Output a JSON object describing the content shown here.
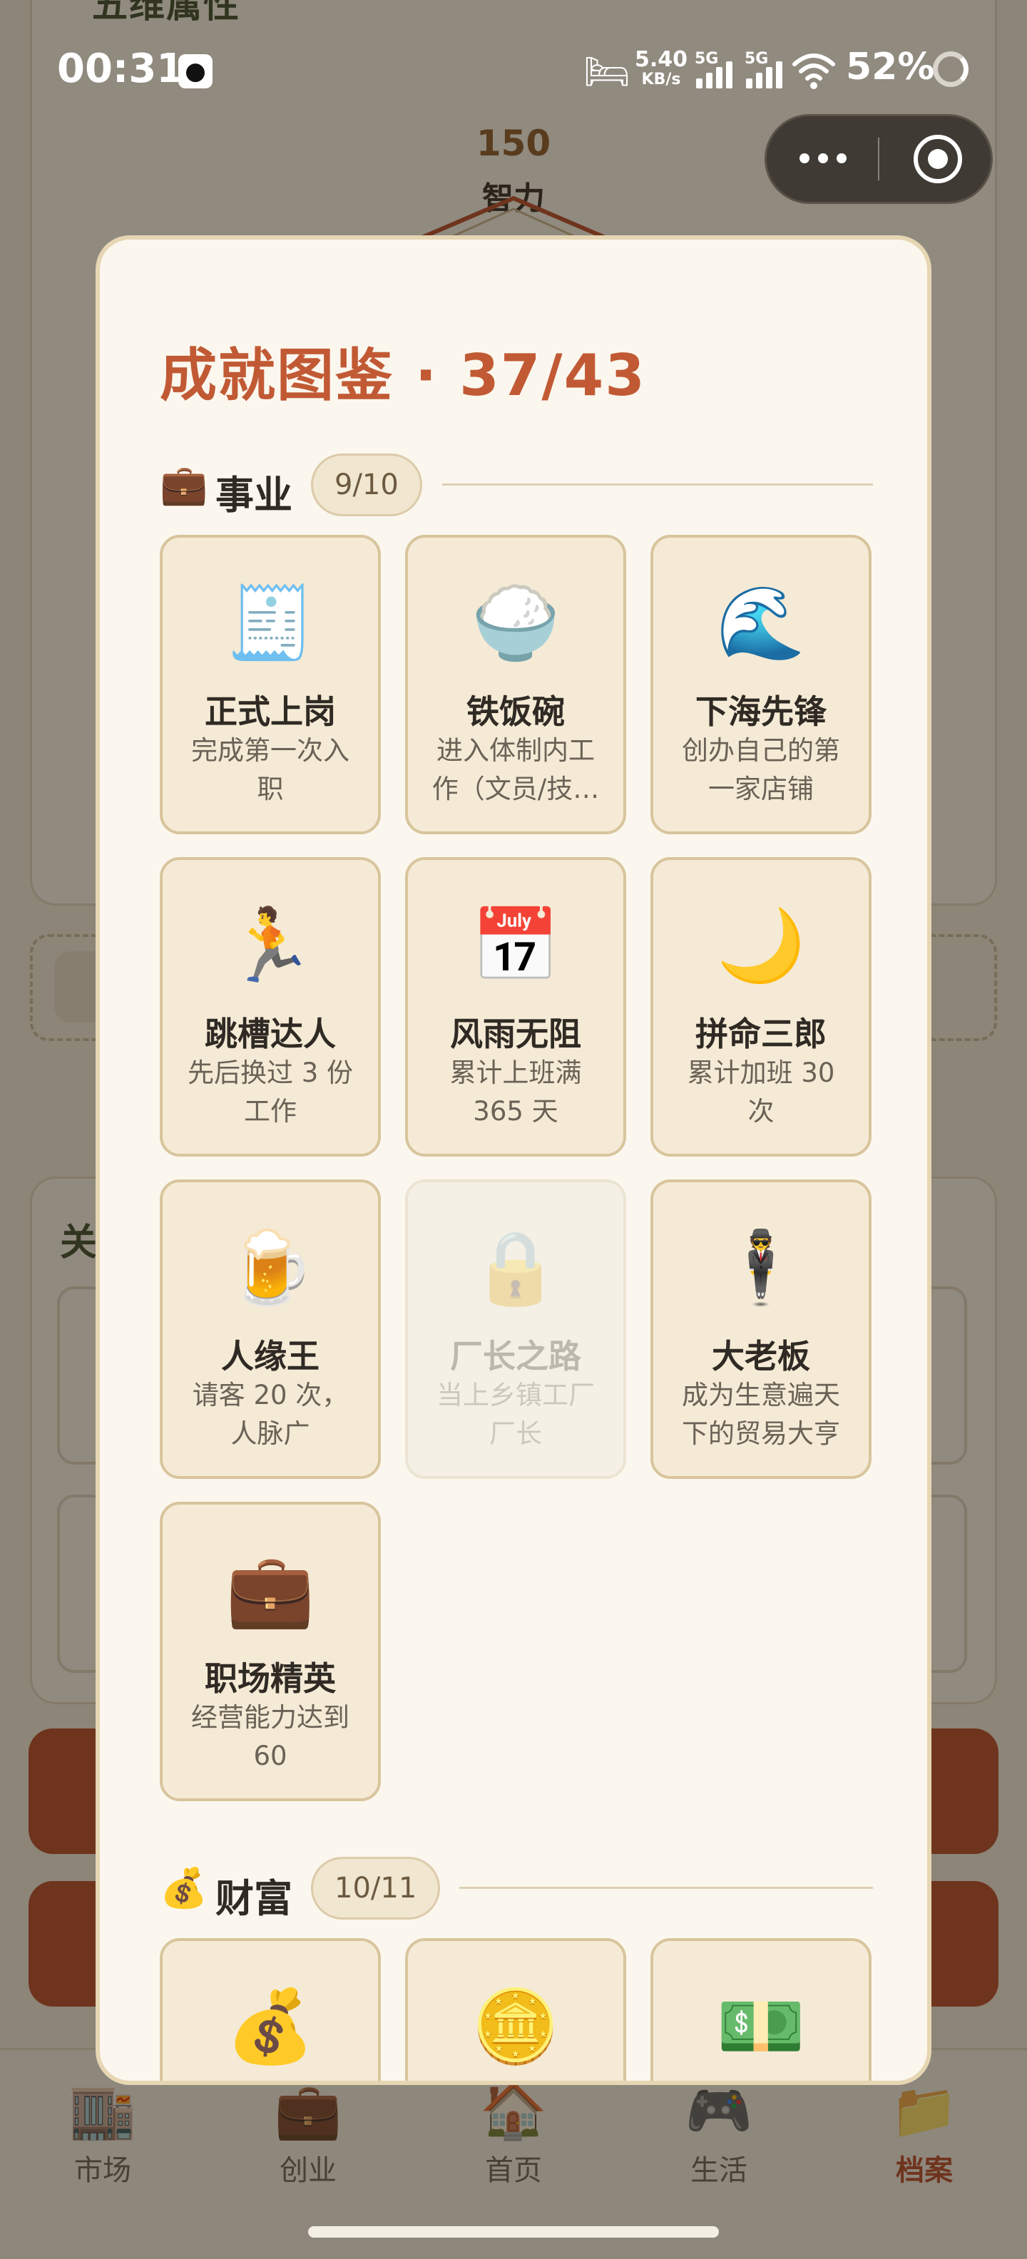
{
  "background": {
    "title": "五维属性",
    "radar_value": "150",
    "radar_label": "智力",
    "section_letter": "关"
  },
  "status_bar": {
    "time": "00:31",
    "speed_value": "5.40",
    "speed_unit": "KB/s",
    "signal_1": "5G",
    "signal_2": "5G",
    "battery": "52%"
  },
  "modal": {
    "title": "成就图鉴 · 37/43",
    "sections": [
      {
        "icon": "💼",
        "label": "事业",
        "count": "9/10",
        "items": [
          {
            "icon": "🧾",
            "name": "正式上岗",
            "desc": "完成第一次入职",
            "locked": false
          },
          {
            "icon": "🍚",
            "name": "铁饭碗",
            "desc": "进入体制内工作（文员/技术员）",
            "locked": false
          },
          {
            "icon": "🌊",
            "name": "下海先锋",
            "desc": "创办自己的第一家店铺",
            "locked": false
          },
          {
            "icon": "🏃",
            "name": "跳槽达人",
            "desc": "先后换过 3 份工作",
            "locked": false
          },
          {
            "icon": "📅",
            "name": "风雨无阻",
            "desc": "累计上班满 365 天",
            "locked": false
          },
          {
            "icon": "🌙",
            "name": "拼命三郎",
            "desc": "累计加班 30 次",
            "locked": false
          },
          {
            "icon": "🍺",
            "name": "人缘王",
            "desc": "请客 20 次，人脉广",
            "locked": false
          },
          {
            "icon": "🔒",
            "name": "厂长之路",
            "desc": "当上乡镇工厂厂长",
            "locked": true
          },
          {
            "icon": "🕴",
            "name": "大老板",
            "desc": "成为生意遍天下的贸易大亨",
            "locked": false
          },
          {
            "icon": "💼",
            "name": "职场精英",
            "desc": "经营能力达到 60",
            "locked": false
          }
        ]
      },
      {
        "icon": "💰",
        "label": "财富",
        "count": "10/11",
        "items": [
          {
            "icon": "💰",
            "name": "",
            "desc": "",
            "locked": false
          },
          {
            "icon": "🪙",
            "name": "",
            "desc": "",
            "locked": false
          },
          {
            "icon": "💵",
            "name": "",
            "desc": "",
            "locked": false
          }
        ]
      }
    ]
  },
  "tabbar": [
    {
      "icon": "🏬",
      "label": "市场",
      "active": false
    },
    {
      "icon": "💼",
      "label": "创业",
      "active": false
    },
    {
      "icon": "🏠",
      "label": "首页",
      "active": false
    },
    {
      "icon": "🎮",
      "label": "生活",
      "active": false
    },
    {
      "icon": "📁",
      "label": "档案",
      "active": true
    }
  ]
}
